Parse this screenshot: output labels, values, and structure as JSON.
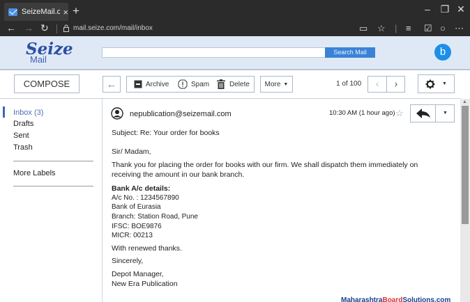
{
  "browser": {
    "tab_title": "SeizeMail.c",
    "tab_close": "×",
    "new_tab": "+",
    "url": "mail.seize.com/mail/inbox",
    "nav": {
      "back": "←",
      "forward": "→",
      "refresh": "↻"
    }
  },
  "app": {
    "logo_word": "Seize",
    "logo_sub": "Mail",
    "search_value": "",
    "search_button": "Search Mail",
    "avatar_letter": "b",
    "colors": {
      "header_bg": "#dfe9f6",
      "accent": "#3a82d6",
      "avatar": "#1c8fe8"
    }
  },
  "toolbar": {
    "compose": "COMPOSE",
    "archive": "Archive",
    "spam": "Spam",
    "delete": "Delete",
    "more": "More",
    "page_count": "1 of 100"
  },
  "sidebar": {
    "items": [
      {
        "label": "Inbox (3)"
      },
      {
        "label": "Drafts"
      },
      {
        "label": "Sent"
      },
      {
        "label": "Trash"
      }
    ],
    "more_labels": "More Labels"
  },
  "message": {
    "from": "nepublication@seizemail.com",
    "time": "10:30 AM (1 hour ago)",
    "subject": "Subject:  Re:  Your order for books",
    "greeting": "Sir/ Madam,",
    "body_line1": "Thank you for placing the order for books with our firm. We shall dispatch them immediately on",
    "body_line2": "receiving the amount in our bank branch.",
    "bank_heading": "Bank A/c details:",
    "bank_lines": [
      "A/c No. : 1234567890",
      "Bank of Eurasia",
      "Branch: Station Road, Pune",
      "IFSC: BOE9876",
      "MICR: 00213"
    ],
    "thanks": "With renewed thanks.",
    "sign_off": "Sincerely,",
    "sign_title": "Depot Manager,",
    "sign_org": "New Era Publication"
  },
  "watermark": {
    "part1": "Maharashtra",
    "part2": "Board",
    "part3": "Solutions",
    "part4": ".com"
  }
}
